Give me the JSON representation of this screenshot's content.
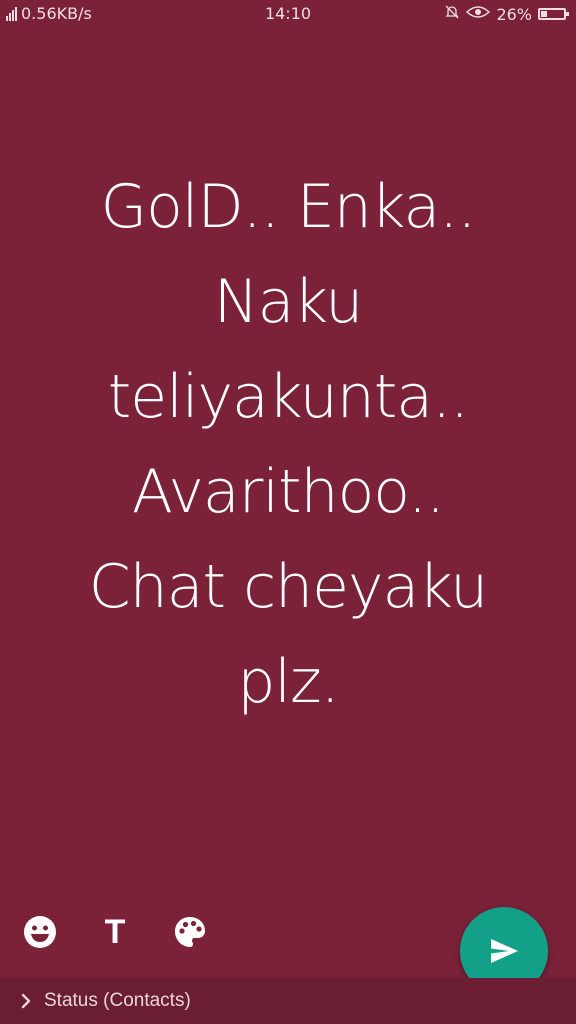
{
  "status_bar": {
    "network_speed": "0.56KB/s",
    "time": "14:10",
    "battery_percent": "26%",
    "battery_level": 0.26
  },
  "status_text": {
    "lines": [
      "GolD.. Enka..",
      "Naku",
      "teliyakunta..",
      "Avarithoo..",
      "Chat cheyaku",
      "plz."
    ]
  },
  "colors": {
    "background": "#7b2239",
    "send_button": "#13a089",
    "bottom_bar": "#6b1d31"
  },
  "toolbar": {
    "emoji_icon": "smiley-icon",
    "text_label": "T",
    "palette_icon": "palette-icon"
  },
  "send_button": {
    "icon": "send-icon"
  },
  "footer": {
    "audience_label": "Status (Contacts)"
  }
}
